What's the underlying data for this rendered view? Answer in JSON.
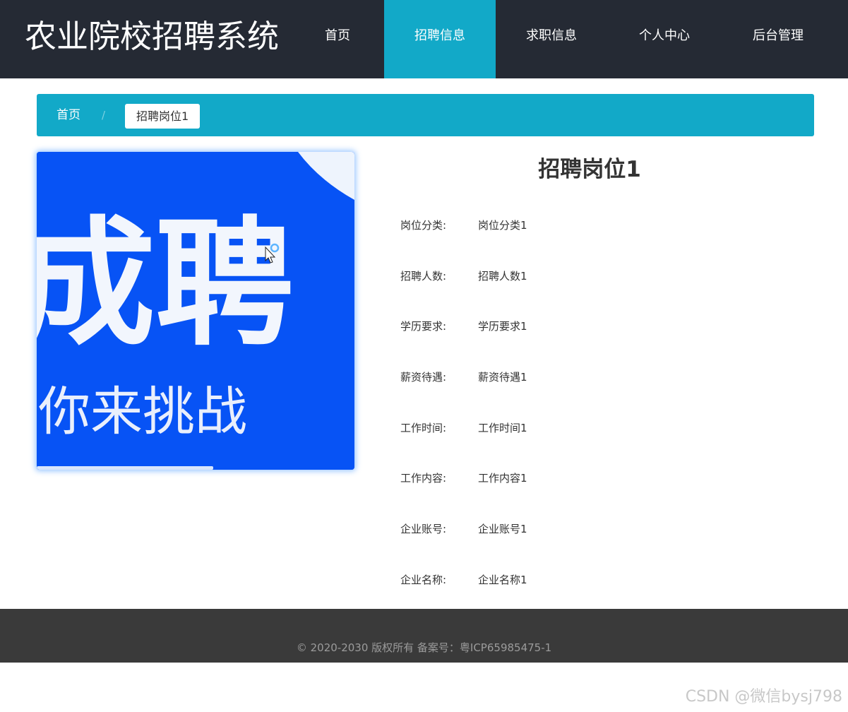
{
  "header": {
    "brand": "农业院校招聘系统",
    "nav": [
      {
        "label": "首页",
        "active": false
      },
      {
        "label": "招聘信息",
        "active": true
      },
      {
        "label": "求职信息",
        "active": false
      },
      {
        "label": "个人中心",
        "active": false
      },
      {
        "label": "后台管理",
        "active": false
      }
    ]
  },
  "breadcrumb": {
    "home": "首页",
    "separator": "/",
    "current": "招聘岗位1"
  },
  "poster": {
    "line1": "成聘",
    "line2": "你来挑战",
    "background": "#0753f5"
  },
  "detail": {
    "title": "招聘岗位1",
    "fields": [
      {
        "label": "岗位分类:",
        "value": "岗位分类1"
      },
      {
        "label": "招聘人数:",
        "value": "招聘人数1"
      },
      {
        "label": "学历要求:",
        "value": "学历要求1"
      },
      {
        "label": "薪资待遇:",
        "value": "薪资待遇1"
      },
      {
        "label": "工作时间:",
        "value": "工作时间1"
      },
      {
        "label": "工作内容:",
        "value": "工作内容1"
      },
      {
        "label": "企业账号:",
        "value": "企业账号1"
      },
      {
        "label": "企业名称:",
        "value": "企业名称1"
      }
    ]
  },
  "footer": {
    "copyright": "© 2020-2030 版权所有 备案号：粤ICP65985475-1"
  },
  "watermark": "CSDN @微信bysj798",
  "colors": {
    "header_bg": "#252a34",
    "accent": "#12a9c8",
    "footer_bg": "#3a3a3a"
  }
}
